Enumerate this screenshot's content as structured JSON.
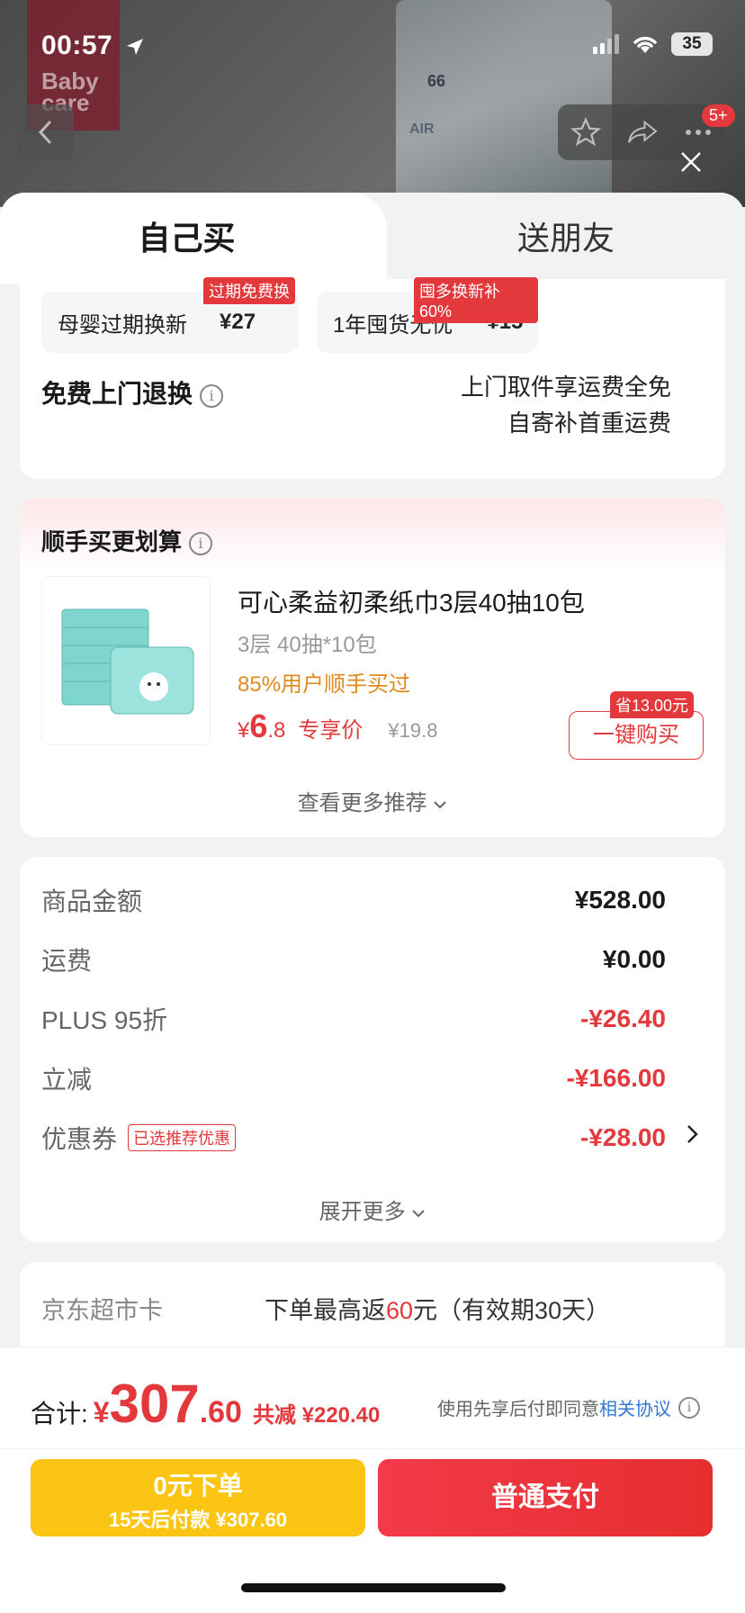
{
  "status_bar": {
    "time": "00:57",
    "battery": "35"
  },
  "header": {
    "badge": "5+",
    "brand_logo": "Baby care"
  },
  "tabs": {
    "self_buy": "自己买",
    "gift": "送朋友"
  },
  "services": [
    {
      "name": "母婴过期换新",
      "price": "¥27",
      "tag": "过期免费换"
    },
    {
      "name": "1年囤货无忧",
      "price": "¥15",
      "tag": "囤多换新补60%"
    }
  ],
  "free_return": {
    "label": "免费上门退换",
    "line1": "上门取件享运费全免",
    "line2": "自寄补首重运费"
  },
  "addon": {
    "title": "顺手买更划算",
    "product_name": "可心柔益初柔纸巾3层40抽10包",
    "spec": "3层 40抽*10包",
    "stat": "85%用户顺手买过",
    "price_currency": "¥",
    "price_int": "6",
    "price_dec": ".8",
    "price_tag": "专享价",
    "old_price": "¥19.8",
    "save_tag": "省13.00元",
    "buy_label": "一键购买",
    "more_label": "查看更多推荐"
  },
  "summary": {
    "rows": [
      {
        "label": "商品金额",
        "value": "¥528.00"
      },
      {
        "label": "运费",
        "value": "¥0.00"
      },
      {
        "label": "PLUS 95折",
        "value": "-¥26.40"
      },
      {
        "label": "立减",
        "value": "-¥166.00"
      },
      {
        "label": "优惠券",
        "value": "-¥28.00",
        "tag": "已选推荐优惠"
      }
    ],
    "expand_label": "展开更多"
  },
  "jd_card": {
    "label": "京东超市卡",
    "text_pre": "下单最高返",
    "text_hl": "60",
    "text_post": "元（有效期30天）"
  },
  "footer": {
    "total_label": "合计:",
    "total_currency": "¥",
    "total_int": "307",
    "total_dec": ".60",
    "savings": "共减 ¥220.40",
    "agree_text": "使用先享后付即同意",
    "agree_link": "相关协议",
    "pay_later_line1": "0元下单",
    "pay_later_line2": "15天后付款 ¥307.60",
    "pay_normal": "普通支付"
  },
  "colors": {
    "accent_red": "#e4393c",
    "pay_yellow": "#fcc514",
    "link_blue": "#2f78d6",
    "stat_orange": "#e08a1e"
  }
}
